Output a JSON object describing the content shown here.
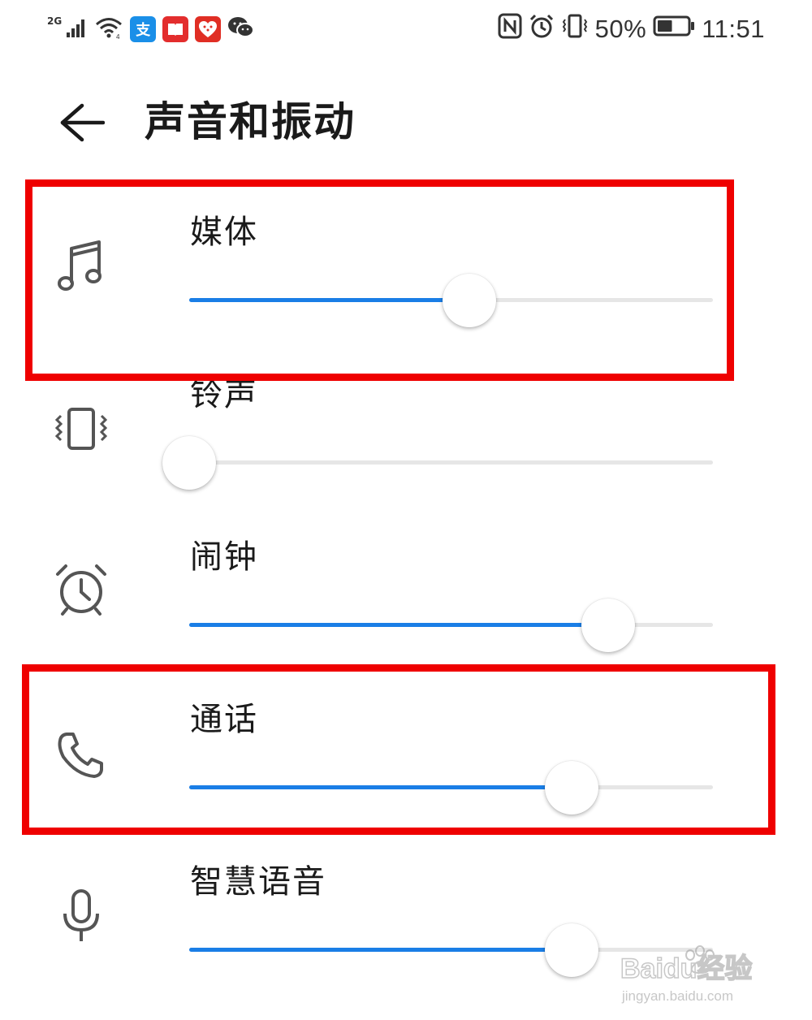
{
  "status_bar": {
    "network_label": "2G",
    "battery_percent": "50%",
    "time": "11:51",
    "battery_level": 0.5,
    "notification_icons": [
      "alipay-icon",
      "reader-icon",
      "pinduoduo-icon",
      "wechat-icon"
    ],
    "system_icons": [
      "nfc-icon",
      "alarm-icon",
      "vibrate-icon",
      "battery-icon"
    ]
  },
  "header": {
    "title": "声音和振动",
    "back_icon": "arrow-left-icon"
  },
  "volume_rows": [
    {
      "label": "媒体",
      "icon": "music-note-icon",
      "level": 0.535,
      "highlighted": true
    },
    {
      "label": "铃声",
      "icon": "vibrate-icon",
      "level": 0.0,
      "highlighted": false
    },
    {
      "label": "闹钟",
      "icon": "alarm-clock-icon",
      "level": 0.8,
      "highlighted": false
    },
    {
      "label": "通话",
      "icon": "phone-icon",
      "level": 0.73,
      "highlighted": true
    },
    {
      "label": "智慧语音",
      "icon": "microphone-icon",
      "level": 0.73,
      "highlighted": false
    }
  ],
  "colors": {
    "accent": "#1a7ee6",
    "track": "#e6e6e6",
    "highlight": "#ef0000"
  },
  "watermark": {
    "brand": "Baidu经验",
    "url": "jingyan.baidu.com"
  }
}
